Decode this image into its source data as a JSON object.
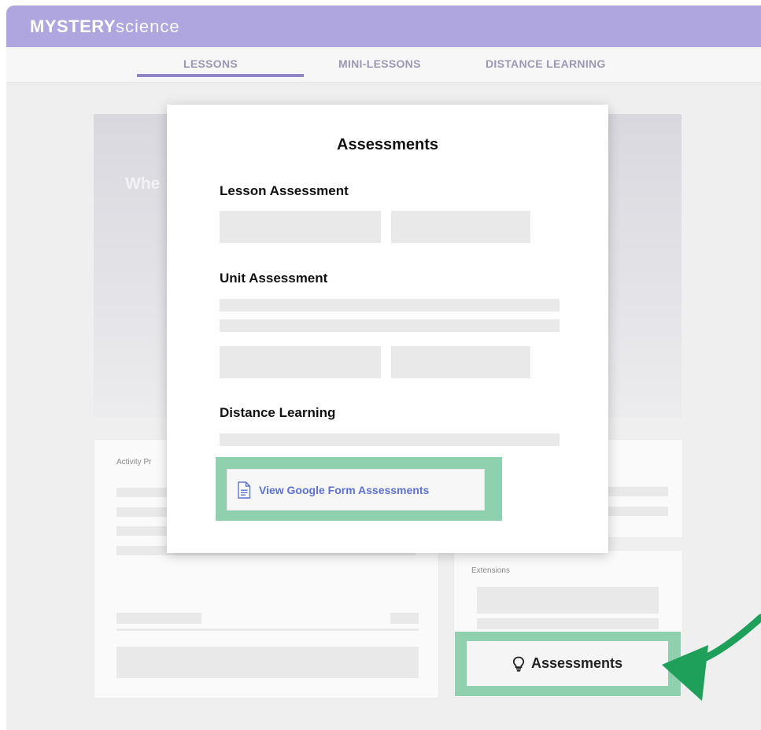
{
  "header": {
    "logo_bold": "MYSTERY",
    "logo_light": "science"
  },
  "nav": {
    "tabs": [
      {
        "label": "LESSONS"
      },
      {
        "label": "MINI-LESSONS"
      },
      {
        "label": "DISTANCE LEARNING"
      }
    ],
    "active_tab": "LESSONS"
  },
  "hero": {
    "partial_title": "Whe"
  },
  "cards": {
    "activity_label": "Activity Pr",
    "extensions_label": "Extensions"
  },
  "assessments_button": {
    "label": "Assessments",
    "icon": "lightbulb-icon"
  },
  "modal": {
    "title": "Assessments",
    "lesson_section": "Lesson Assessment",
    "unit_section": "Unit Assessment",
    "distance_section": "Distance Learning",
    "google_form_button": {
      "label": "View Google Form Assessments",
      "icon": "document-icon"
    }
  },
  "colors": {
    "brand": "#b0a6df",
    "highlight": "#8fd0af",
    "arrow": "#1fa05a",
    "link": "#5b72d3"
  }
}
